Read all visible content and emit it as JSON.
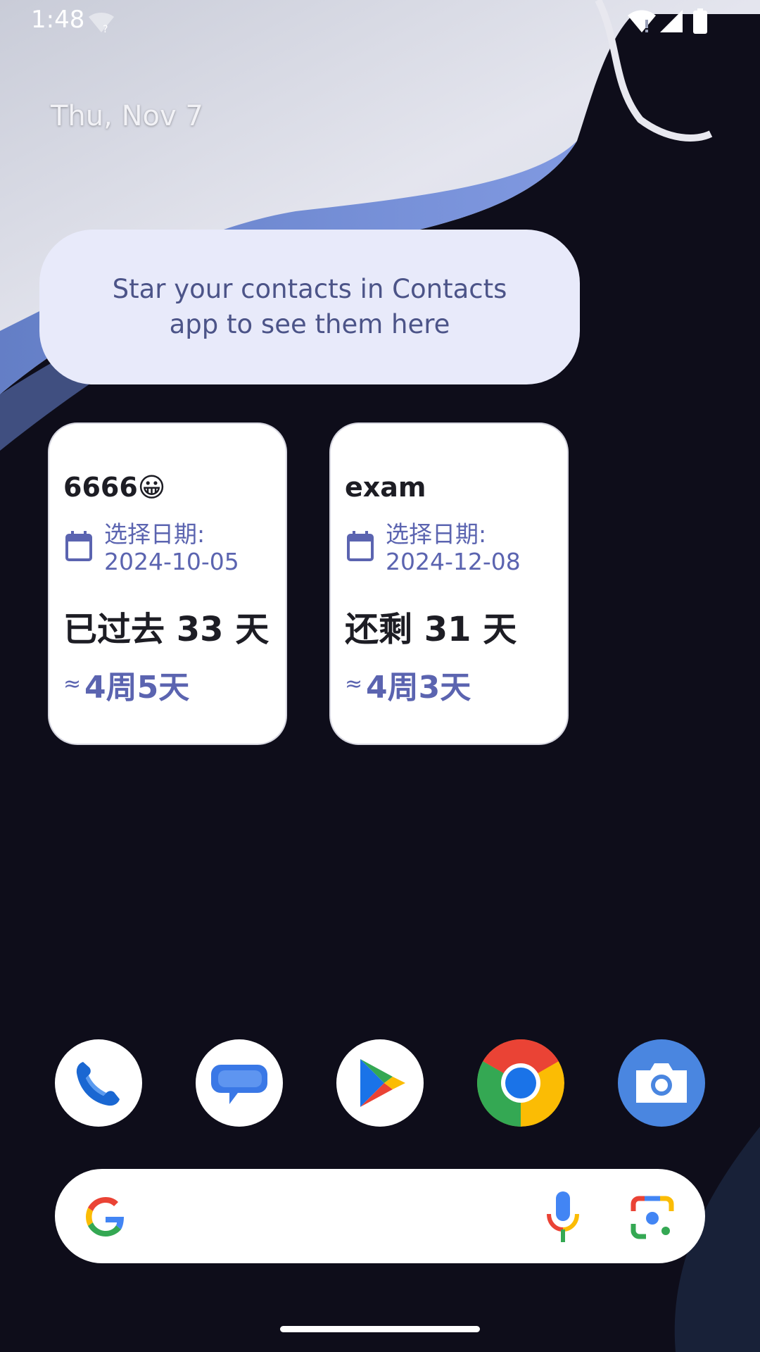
{
  "status_bar": {
    "time": "1:48",
    "icons": [
      "wifi-unknown-icon",
      "wifi-icon",
      "signal-icon",
      "battery-icon"
    ]
  },
  "home": {
    "date": "Thu, Nov 7"
  },
  "contacts_widget": {
    "message": "Star your contacts in Contacts app to see them here"
  },
  "countdown_cards": [
    {
      "title": "6666😀",
      "date_label": "选择日期:",
      "date_value": "2024-10-05",
      "days_text": "已过去 33 天",
      "approx_symbol": "≈",
      "approx_value": "4周5天",
      "icon": "calendar-icon"
    },
    {
      "title": "exam",
      "date_label": "选择日期:",
      "date_value": "2024-12-08",
      "days_text": "还剩 31 天",
      "approx_symbol": "≈",
      "approx_value": "4周3天",
      "icon": "calendar-icon"
    }
  ],
  "dock": {
    "apps": [
      {
        "icon": "phone-icon"
      },
      {
        "icon": "messages-icon"
      },
      {
        "icon": "play-store-icon"
      },
      {
        "icon": "chrome-icon"
      },
      {
        "icon": "camera-icon"
      }
    ]
  },
  "search_bar": {
    "icons": [
      "google-g-icon",
      "microphone-icon",
      "google-lens-icon"
    ]
  },
  "colors": {
    "accent": "#5b64b0",
    "contacts_bg": "#e8eafa",
    "wallpaper_dark": "#0e0d1a"
  }
}
